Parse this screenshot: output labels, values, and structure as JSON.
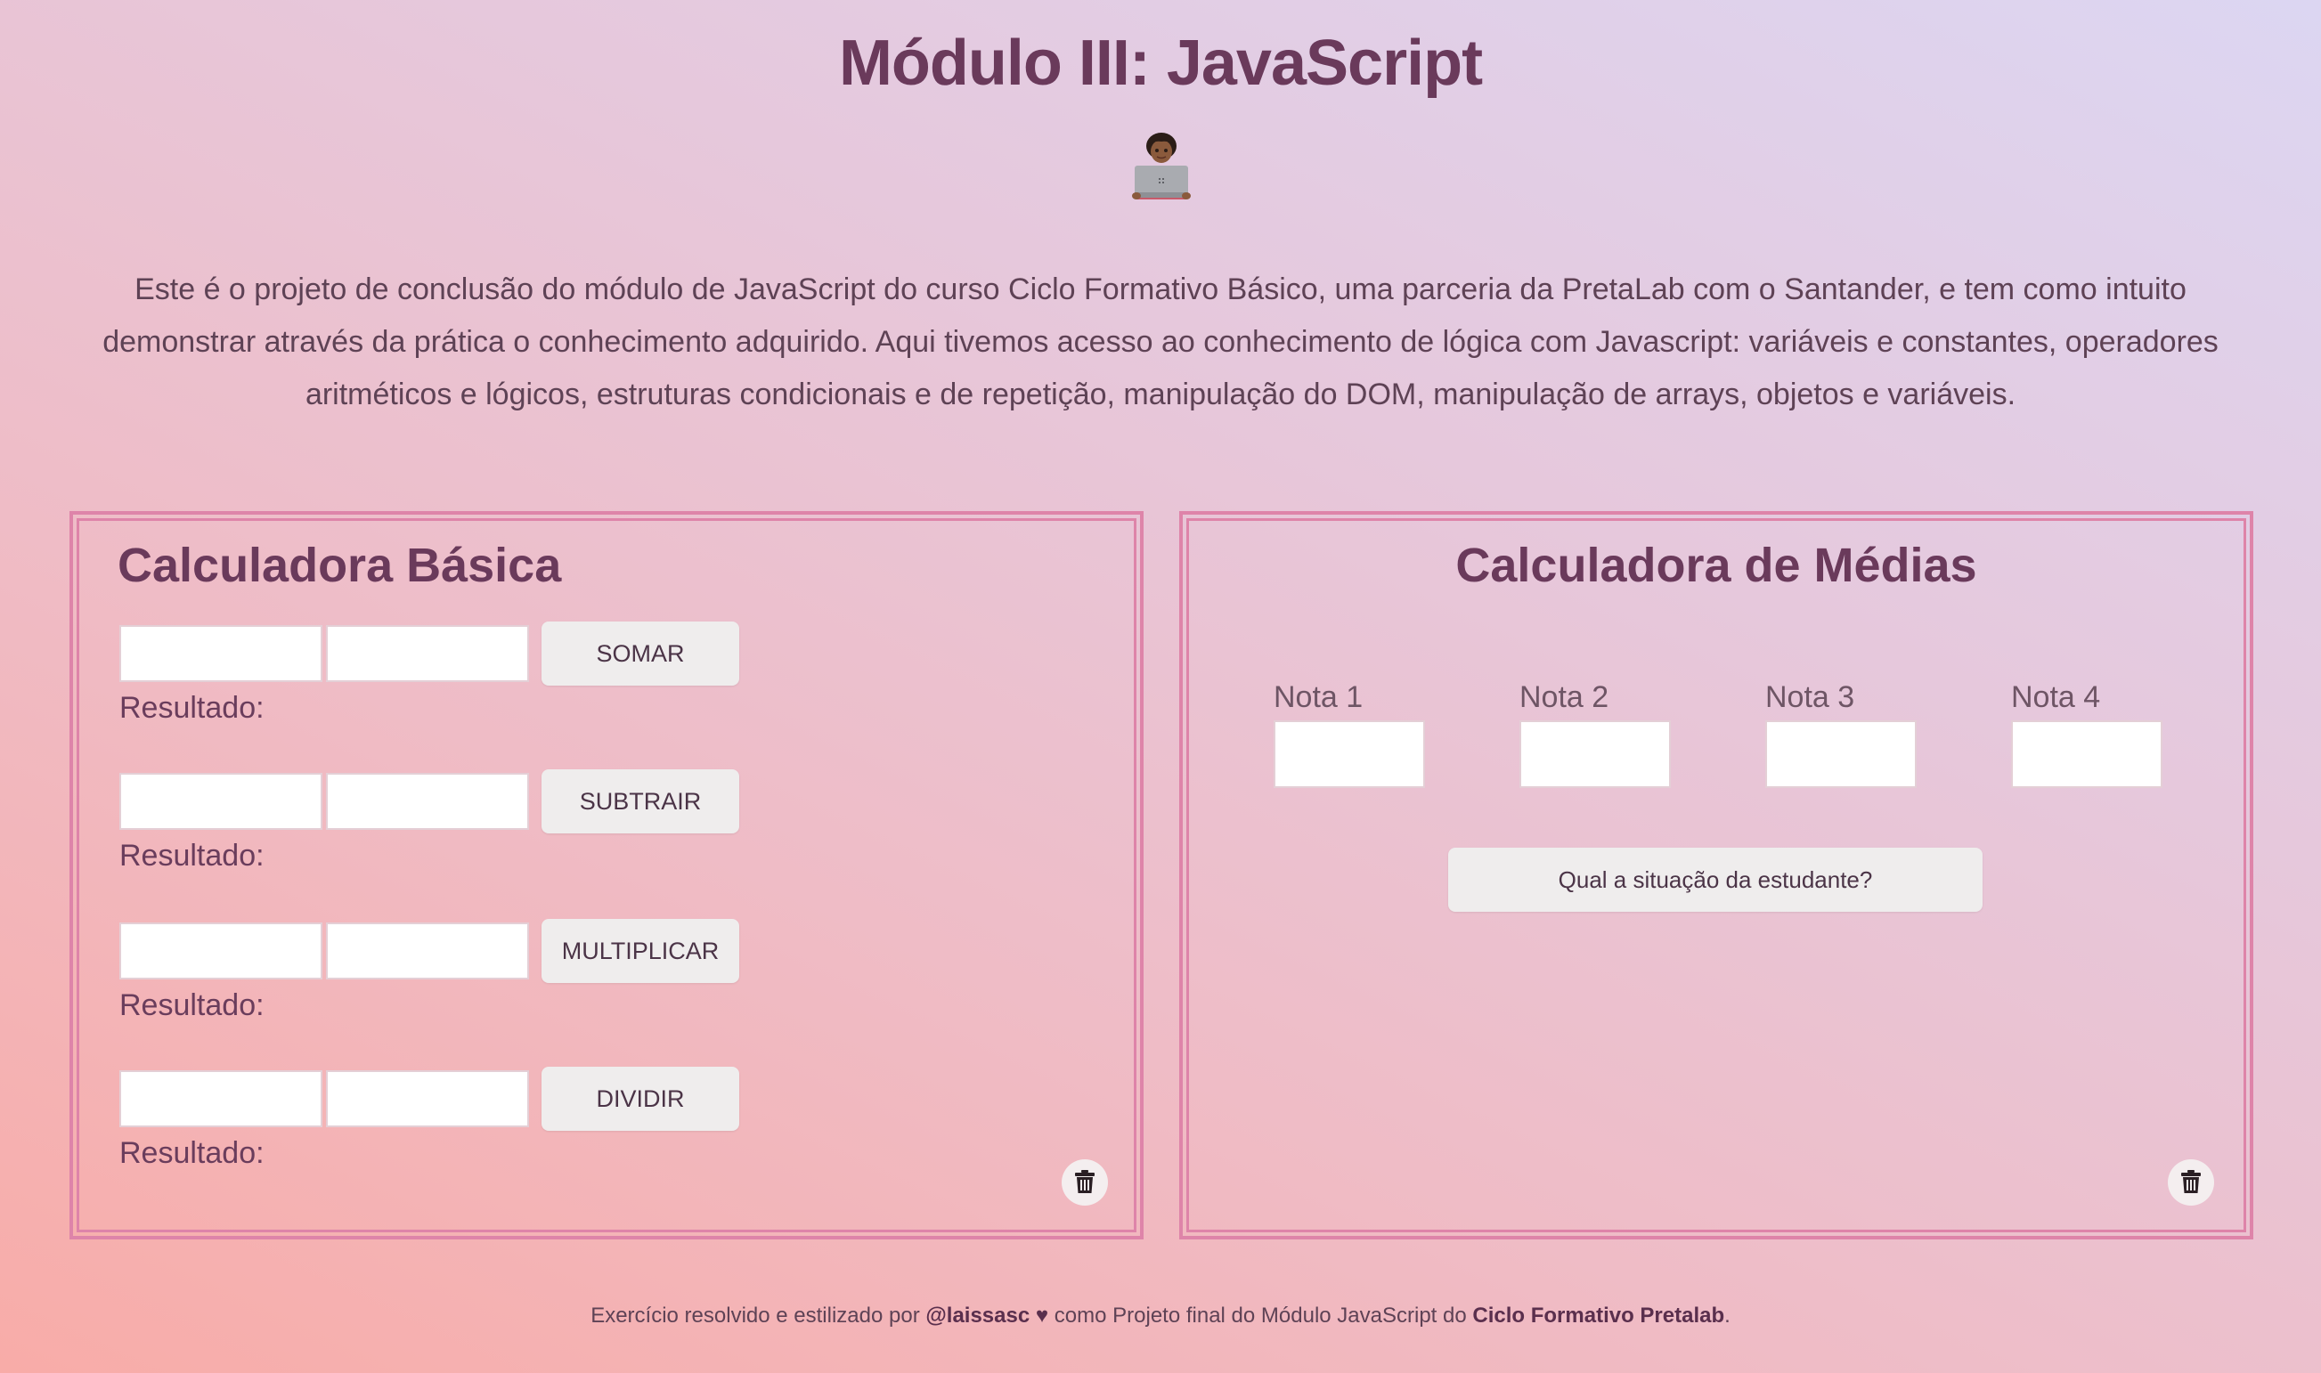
{
  "header": {
    "title": "Módulo III: JavaScript",
    "hero_icon": "woman-technologist-icon"
  },
  "intro": {
    "text": "Este é o projeto de conclusão do módulo de JavaScript do curso Ciclo Formativo Básico, uma parceria da PretaLab com o Santander, e tem como intuito demonstrar através da prática o conhecimento adquirido. Aqui tivemos acesso ao conhecimento de lógica com Javascript: variáveis e constantes, operadores aritméticos e lógicos, estruturas condicionais e de repetição, manipulação do DOM, manipulação de arrays, objetos e variáveis."
  },
  "basic_calculator": {
    "title": "Calculadora Básica",
    "result_label": "Resultado:",
    "operations": [
      {
        "label": "SOMAR",
        "value_a": "",
        "value_b": "",
        "result": ""
      },
      {
        "label": "SUBTRAIR",
        "value_a": "",
        "value_b": "",
        "result": ""
      },
      {
        "label": "MULTIPLICAR",
        "value_a": "",
        "value_b": "",
        "result": ""
      },
      {
        "label": "DIVIDIR",
        "value_a": "",
        "value_b": "",
        "result": ""
      }
    ],
    "clear_icon": "trash-icon"
  },
  "average_calculator": {
    "title": "Calculadora de Médias",
    "grades": [
      {
        "label": "Nota 1",
        "value": ""
      },
      {
        "label": "Nota 2",
        "value": ""
      },
      {
        "label": "Nota 3",
        "value": ""
      },
      {
        "label": "Nota 4",
        "value": ""
      }
    ],
    "button_label": "Qual a situação da estudante?",
    "situation": "",
    "clear_icon": "trash-icon"
  },
  "footer": {
    "prefix": "Exercício resolvido e estilizado por",
    "author": "@laissasc",
    "heart": "♥",
    "middle": "como Projeto final do Módulo JavaScript do",
    "course": "Ciclo Formativo Pretalab",
    "suffix": "."
  },
  "colors": {
    "title": "#6a3a5b",
    "card_border": "#de84a9",
    "button_bg": "#efeded"
  }
}
